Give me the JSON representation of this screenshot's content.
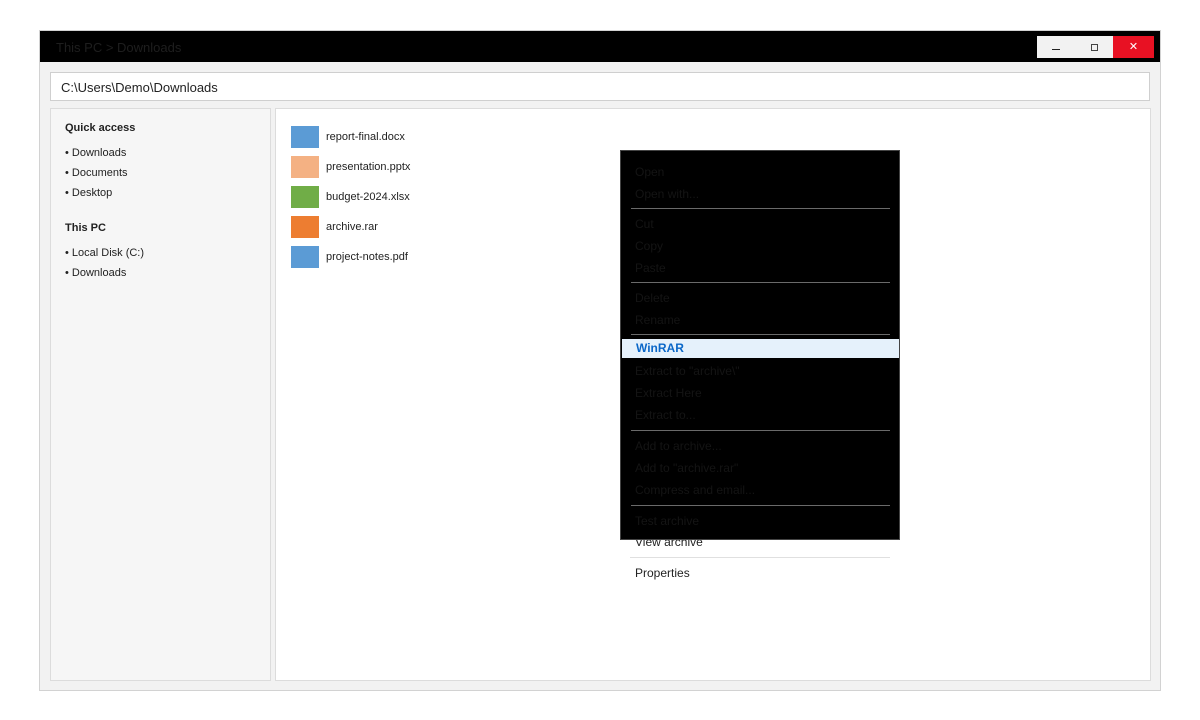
{
  "window": {
    "title": "This PC > Downloads",
    "controls": {
      "minimize": "minimize-icon",
      "maximize": "maximize-icon",
      "close": "close-icon"
    }
  },
  "address_bar": {
    "path": "C:\\Users\\Demo\\Downloads"
  },
  "sidebar": {
    "quick_access_title": "Quick access",
    "quick_access_items": [
      "• Downloads",
      "• Documents",
      "• Desktop"
    ],
    "this_pc_title": "This PC",
    "this_pc_items": [
      "• Local Disk (C:)",
      "• Downloads"
    ]
  },
  "files": [
    {
      "name": "report-final.docx",
      "color": "#5b9bd5"
    },
    {
      "name": "presentation.pptx",
      "color": "#f4b183"
    },
    {
      "name": "budget-2024.xlsx",
      "color": "#70ad47"
    },
    {
      "name": "archive.rar",
      "color": "#ed7d31"
    },
    {
      "name": "project-notes.pdf",
      "color": "#5b9bd5"
    }
  ],
  "context_menu": {
    "items": [
      "Open",
      "Open with...",
      "Cut",
      "Copy",
      "Paste",
      "Delete",
      "Rename",
      "WinRAR",
      "Extract to \"archive\\\"",
      "Extract Here",
      "Extract to...",
      "Add to archive...",
      "Add to \"archive.rar\"",
      "Compress and email...",
      "Test archive"
    ],
    "highlighted": "WinRAR",
    "highlight_color": "#e5f1fb",
    "highlight_text_color": "#0a67c8",
    "overflow_items": [
      "View archive",
      "Properties"
    ]
  },
  "colors": {
    "close_button": "#e81123",
    "titlebar": "#000000"
  }
}
